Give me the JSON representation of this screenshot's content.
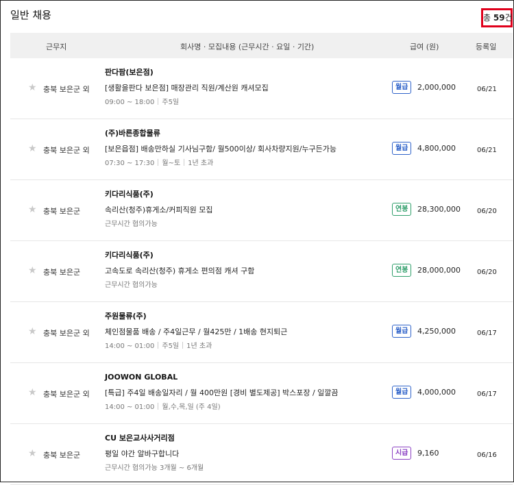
{
  "header": {
    "title": "일반 채용",
    "total_prefix": "총 ",
    "total_count": "59",
    "total_suffix": "건"
  },
  "table": {
    "columns": {
      "location": "근무지",
      "job": "회사명 · 모집내용 (근무시간 · 요일 · 기간)",
      "pay": "급여 (원)",
      "date": "등록일"
    }
  },
  "colors": {
    "monthly": "#2e62c9",
    "yearly": "#2f9e6a",
    "hourly": "#8a3fc2",
    "highlight_border": "#e0001b"
  },
  "rows": [
    {
      "location": "충북 보은군 외",
      "company": "판다팜(보은점)",
      "description": "[생활을판다 보은점] 매장관리 직원/계산원 캐셔모집",
      "conditions": [
        "09:00 ~ 18:00",
        "주5일"
      ],
      "pay_type": "월급",
      "pay_kind": "monthly",
      "pay": "2,000,000",
      "date": "06/21"
    },
    {
      "location": "충북 보은군 외",
      "company": "(주)바른종합물류",
      "description": "[보은읍점] 배송만하실 기사님구함/ 월500이상/ 회사차량지원/누구든가능",
      "conditions": [
        "07:30 ~ 17:30",
        "월~토",
        "1년 초과"
      ],
      "pay_type": "월급",
      "pay_kind": "monthly",
      "pay": "4,800,000",
      "date": "06/21"
    },
    {
      "location": "충북 보은군",
      "company": "키다리식품(주)",
      "description": "속리산(청주)휴게소/커피직원 모집",
      "conditions": [
        "근무시간 협의가능"
      ],
      "pay_type": "연봉",
      "pay_kind": "yearly",
      "pay": "28,300,000",
      "date": "06/20"
    },
    {
      "location": "충북 보은군",
      "company": "키다리식품(주)",
      "description": "고속도로 속리산(청주) 휴게소 편의점 캐셔 구함",
      "conditions": [
        "근무시간 협의가능"
      ],
      "pay_type": "연봉",
      "pay_kind": "yearly",
      "pay": "28,000,000",
      "date": "06/20"
    },
    {
      "location": "충북 보은군 외",
      "company": "주원물류(주)",
      "description": "체인점물품 배송 / 주4일근무 / 월425만 / 1배송 현지퇴근",
      "conditions": [
        "14:00 ~ 01:00",
        "주5일",
        "1년 초과"
      ],
      "pay_type": "월급",
      "pay_kind": "monthly",
      "pay": "4,250,000",
      "date": "06/17"
    },
    {
      "location": "충북 보은군 외",
      "company": "JOOWON GLOBAL",
      "description": "[특급] 주4일 배송일자리 / 월 400만원 [경비 별도제공] 박스포장 / 일깔끔",
      "conditions": [
        "14:00 ~ 01:00",
        "월,수,목,일 (주 4일)"
      ],
      "pay_type": "월급",
      "pay_kind": "monthly",
      "pay": "4,000,000",
      "date": "06/17"
    },
    {
      "location": "충북 보은군",
      "company": "CU 보은교사사거리점",
      "description": "평일 야간 알바구합니다",
      "conditions": [
        "근무시간 협의가능 3개월 ~ 6개월"
      ],
      "pay_type": "시급",
      "pay_kind": "hourly",
      "pay": "9,160",
      "date": "06/16"
    }
  ]
}
